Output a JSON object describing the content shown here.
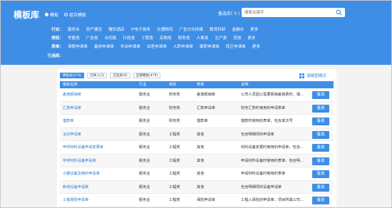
{
  "header": {
    "title": "模板库",
    "radio_options": [
      {
        "label": "模板",
        "selected": true
      },
      {
        "label": "组合模板",
        "selected": false
      }
    ],
    "selected_label": "备选库( 0 )",
    "search": {
      "placeholder": "搜索关键字"
    }
  },
  "filters": {
    "industry": {
      "label": "行业：",
      "items": [
        "服务业",
        "房产建设",
        "餐饮酒店",
        "IT电子商务",
        "交通物流",
        "广告文化传媒",
        "教育科研",
        "金融业",
        "更多"
      ]
    },
    "category": {
      "label": "类别：",
      "items": [
        "考勤类",
        "广告类",
        "合同类",
        "行政类",
        "工程类",
        "采购类",
        "财务类",
        "人事类",
        "生产类",
        "其他",
        "更多"
      ]
    },
    "table": {
      "label": "表单：",
      "items": [
        "请假申请单",
        "备休申请单",
        "外出申请单",
        "出差申请单",
        "入职申请单",
        "离职申请单",
        "转正申请单",
        "更多"
      ]
    },
    "chosen": {
      "label": "已选择："
    }
  },
  "tabs": [
    "模板表(474)",
    "已导入(1)",
    "已选表(0)",
    "全部模板(474)"
  ],
  "view_mode": "缩略图模式",
  "table": {
    "columns": [
      "模板名称",
      "行业",
      "类别",
      "表单",
      "说明"
    ],
    "action_label": "备选",
    "rows": [
      {
        "name": "差旅报销单",
        "industry": "服务业",
        "category": "财务类",
        "form": "差旅报销单",
        "desc": "公司人员因公需要报销差旅费时，填..."
      },
      {
        "name": "汇款申请单",
        "industry": "服务业",
        "category": "财务类",
        "form": "汇款申请单",
        "desc": "财务汇款时使用的申请表单"
      },
      {
        "name": "借款单",
        "industry": "服务业",
        "category": "财务类",
        "form": "借款单",
        "desc": "借款时使用的表单，包含其次号"
      },
      {
        "name": "洽切申请单",
        "industry": "服务业",
        "category": "工程类",
        "form": "其他",
        "desc": "包含明细项的申请单"
      },
      {
        "name": "甲供材料设备申请变更单",
        "industry": "服务业",
        "category": "工程类",
        "form": "其他",
        "desc": "材料设备变更时使用的申请单，包含..."
      },
      {
        "name": "甲供材料设备申请单",
        "industry": "服务业",
        "category": "工程类",
        "form": "其他",
        "desc": "申请材料设备时使用的表单，包含明..."
      },
      {
        "name": "小额设备及物料申请单",
        "industry": "服务业",
        "category": "工程类",
        "form": "其他",
        "desc": "申请材料设备时使用的表单"
      },
      {
        "name": "新增设备申请单",
        "industry": "服务业",
        "category": "工程类",
        "form": "其他",
        "desc": "包含明细项的设备申请单"
      },
      {
        "name": "工程保险申请单",
        "industry": "服务业",
        "category": "工程类",
        "form": "保险申请单",
        "desc": "工程入保险的申请单，项目所属公司..."
      }
    ]
  },
  "colors": {
    "accent": "#3e8ee6",
    "link": "#2f78d0"
  }
}
